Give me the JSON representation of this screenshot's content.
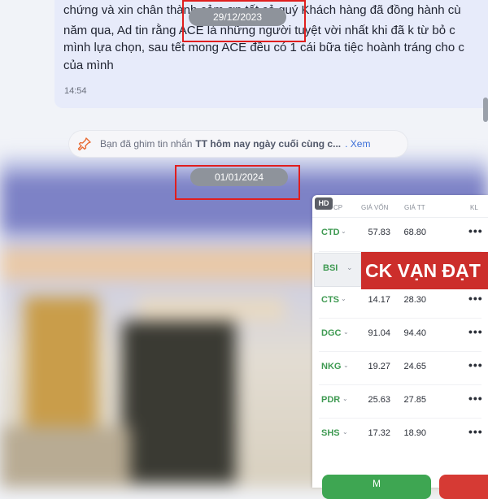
{
  "message": {
    "lines": [
      "chứng và xin chân thành cảm ơn tất cả quý Khách hàng đã đồng hành cù",
      "năm qua, Ad tin rằng ACE là những người tuyệt vời nhất khi đã k từ bỏ c",
      "mình lựa chọn, sau tết mong ACE đều có 1 cái bữa tiệc hoành tráng cho c",
      "của mình"
    ],
    "time": "14:54"
  },
  "date_divider_1": "29/12/2023",
  "date_divider_2": "01/01/2024",
  "pinned": {
    "prefix": "Bạn đã ghim tin nhắn",
    "title": "TT hôm nay ngày cuối cùng c...",
    "link": ". Xem"
  },
  "stock_table": {
    "badge": "HD",
    "headers": {
      "symbol": "CP",
      "cost": "GIÁ VỐN",
      "price": "GIÁ TT",
      "qty": "KL"
    },
    "selected_symbol": "BSI",
    "rows": [
      {
        "symbol": "CTD",
        "cost": "57.83",
        "price": "68.80"
      },
      {
        "symbol": "CTS",
        "cost": "14.17",
        "price": "28.30"
      },
      {
        "symbol": "DGC",
        "cost": "91.04",
        "price": "94.40"
      },
      {
        "symbol": "NKG",
        "cost": "19.27",
        "price": "24.65"
      },
      {
        "symbol": "PDR",
        "cost": "25.63",
        "price": "27.85"
      },
      {
        "symbol": "SHS",
        "cost": "17.32",
        "price": "18.90"
      }
    ],
    "more_label": "•••",
    "buy_label": "M",
    "banner": "CK VẠN ĐẠT"
  },
  "colors": {
    "highlight_box": "#e01e1e",
    "symbol_green": "#3f9a52",
    "banner_red": "#cc2e2b"
  }
}
